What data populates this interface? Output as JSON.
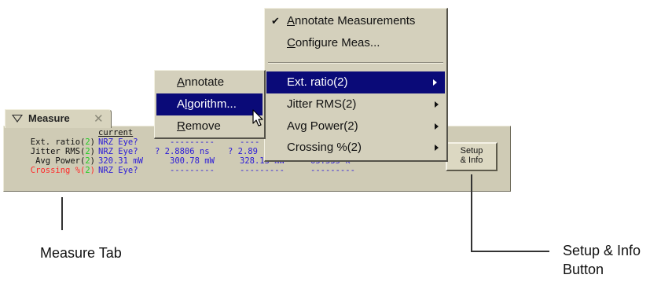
{
  "panel": {
    "tab_label": "Measure",
    "close_glyph": "✕",
    "column_header": "current",
    "rows": [
      {
        "name": "Ext. ratio",
        "index": "2",
        "values": [
          "NRZ Eye?",
          "---------",
          "----"
        ]
      },
      {
        "name": "Jitter RMS",
        "index": "2",
        "values": [
          "NRZ Eye?",
          "? 2.8806 ns",
          "? 2.89"
        ]
      },
      {
        "name": "Avg Power",
        "index": "2",
        "values": [
          "320.31 mW",
          "300.78 mW",
          "328.13 mW",
          "65.535 k"
        ]
      },
      {
        "name": "Crossing %",
        "index": "2",
        "values": [
          "NRZ Eye?",
          "---------",
          "---------",
          "---------"
        ]
      }
    ],
    "setup_button": {
      "line1": "Setup",
      "line2": "& Info"
    }
  },
  "main_menu": {
    "check_glyph": "✔",
    "items": [
      {
        "pre": "",
        "ul": "A",
        "rest": "nnotate Measurements"
      },
      {
        "pre": "",
        "ul": "C",
        "rest": "onfigure Meas..."
      },
      {
        "label": "Ext. ratio(2)"
      },
      {
        "label": "Jitter RMS(2)"
      },
      {
        "label": "Avg Power(2)"
      },
      {
        "label": "Crossing %(2)"
      }
    ]
  },
  "sub_menu": {
    "items": [
      {
        "pre": "",
        "ul": "A",
        "rest": "nnotate"
      },
      {
        "pre": "A",
        "ul": "l",
        "rest": "gorithm..."
      },
      {
        "pre": "",
        "ul": "R",
        "rest": "emove"
      }
    ]
  },
  "callouts": {
    "measure_tab": "Measure Tab",
    "setup_line1": "Setup & Info",
    "setup_line2": "Button"
  }
}
